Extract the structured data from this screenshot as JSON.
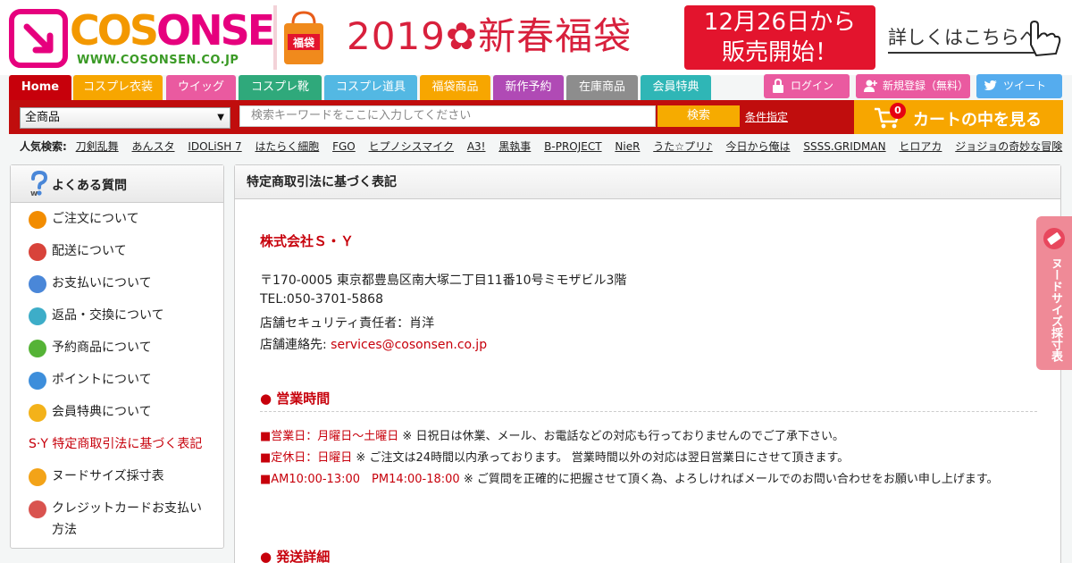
{
  "logo": {
    "text_a": "COS",
    "text_b": "ONSEN",
    "url": "WWW.COSONSEN.CO.JP"
  },
  "banner": {
    "bag_label": "福袋",
    "headline": "2019✿新春福袋",
    "box_line1": "12月26日から",
    "box_line2": "販売開始！",
    "more": "詳しくはこちらへ"
  },
  "nav": {
    "tabs": [
      {
        "label": "Home",
        "color": "#c7000b"
      },
      {
        "label": "コスプレ衣装",
        "color": "#f7a600"
      },
      {
        "label": "ウイッグ",
        "color": "#ea5aa0"
      },
      {
        "label": "コスプレ靴",
        "color": "#2fa97b"
      },
      {
        "label": "コスプレ道具",
        "color": "#53b8e3"
      },
      {
        "label": "福袋商品",
        "color": "#f7a600"
      },
      {
        "label": "新作予約",
        "color": "#b04ab5"
      },
      {
        "label": "在庫商品",
        "color": "#8d8d8d"
      },
      {
        "label": "会員特典",
        "color": "#2fb6b6"
      }
    ],
    "login": "ログイン",
    "register": "新規登録（無料）",
    "tweet": "ツイート"
  },
  "search": {
    "category": "全商品",
    "placeholder": "検索キーワードをここに入力してください",
    "button": "検索",
    "condition": "条件指定"
  },
  "cart": {
    "count": "0",
    "label": "カートの中を見る"
  },
  "popular": {
    "label": "人気検索:",
    "keywords": [
      "刀剣乱舞",
      "あんスタ",
      "IDOLiSH 7",
      "はたらく細胞",
      "FGO",
      "ヒプノシスマイク",
      "A3!",
      "黒執事",
      "B-PROJECT",
      "NieR",
      "うた☆プリ♪",
      "今日から俺は",
      "SSSS.GRIDMAN",
      "ヒロアカ",
      "ジョジョの奇妙な冒険"
    ]
  },
  "sidebar": {
    "title": "よくある質問",
    "items": [
      {
        "label": "ご注文について",
        "color": "#f28c00"
      },
      {
        "label": "配送について",
        "color": "#d8433a"
      },
      {
        "label": "お支払いについて",
        "color": "#4a87d8"
      },
      {
        "label": "返品・交換について",
        "color": "#3dadc8"
      },
      {
        "label": "予約商品について",
        "color": "#55b336"
      },
      {
        "label": "ポイントについて",
        "color": "#3d8edb"
      },
      {
        "label": "会員特典について",
        "color": "#f3b21a"
      },
      {
        "label": "S·Y 特定商取引法に基づく表記",
        "color": ""
      },
      {
        "label": "ヌードサイズ採寸表",
        "color": "#f3a318"
      },
      {
        "label": "クレジットカードお支払い",
        "label2": "方法",
        "color": "#d9534f"
      }
    ]
  },
  "main": {
    "title": "特定商取引法に基づく表記",
    "company": "株式会社Ｓ・Ｙ",
    "address": "〒170-0005 東京都豊島区南大塚二丁目11番10号ミモザビル3階",
    "tel": "TEL:050-3701-5868",
    "security": "店舗セキュリティ責任者：肖洋",
    "contact_label": "店舗連絡先: ",
    "contact_email": "services@cosonsen.co.jp",
    "hours_title": "● 営業時間",
    "hours": [
      {
        "red": "■営業日：月曜日〜土曜日",
        "text": "  ※ 日祝日は休業、メール、お電話などの対応も行っておりませんのでご了承下さい。"
      },
      {
        "red": "■定休日：日曜日",
        "text": "  ※ ご注文は24時間以内承っております。 営業時間以外の対応は翌日営業日にさせて頂きます。"
      },
      {
        "red": "■AM10:00-13:00　PM14:00-18:00",
        "text": "  ※ ご質問を正確的に把握させて頂く為、よろしければメールでのお問い合わせをお願い申し上げます。"
      }
    ],
    "shipping_title": "● 発送詳細"
  },
  "sidetab": {
    "label": "ヌードサイズ採寸表"
  }
}
